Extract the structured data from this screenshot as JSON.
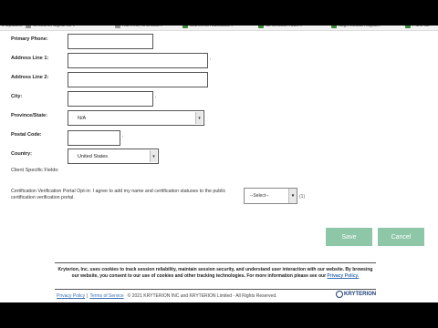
{
  "bookmarks": [
    {
      "label": "s Updates"
    },
    {
      "label": "Ci search signal ac v"
    },
    {
      "label": "rran reu, nina basi..."
    },
    {
      "label": "aruments ruusuuuu..."
    },
    {
      "label": "au umucan rade..."
    },
    {
      "label": "augs issuuu rragaa..."
    },
    {
      "label": "Pane as"
    }
  ],
  "form": {
    "primary_phone_label": "Primary Phone:",
    "address1_label": "Address Line 1:",
    "address2_label": "Address Line 2:",
    "city_label": "City:",
    "province_label": "Province/State:",
    "province_value": "N/A",
    "postal_label": "Postal Code:",
    "country_label": "Country:",
    "country_value": "United States",
    "client_fields_label": "Client Specific Fields:",
    "cert_text": "Certification Verification Portal Opt-in: I agree to add my name and certification statuses to the public certification verification portal.",
    "cert_select_value": "--Select--",
    "cert_q": "(1)"
  },
  "buttons": {
    "save": "Save",
    "cancel": "Cancel"
  },
  "cookie": {
    "text": "Kryterion, Inc. uses cookies to track session reliability, maintain session security, and understand user interaction with our website. By browsing our website, you consent to our use of cookies and other tracking technologies. For more information please see our",
    "link": "Privacy Policy."
  },
  "footer": {
    "privacy": "Privacy Policy",
    "sep": "|",
    "terms": "Terms of Service",
    "copyright": "© 2021 KRYTERION INC and KRYTERION Limited - All Rights Reserved.",
    "logo": "KRYTERION"
  },
  "colors": {
    "button_green": "#8ec6a8",
    "link_blue": "#3a6fb5",
    "logo_navy": "#1d3f78"
  }
}
